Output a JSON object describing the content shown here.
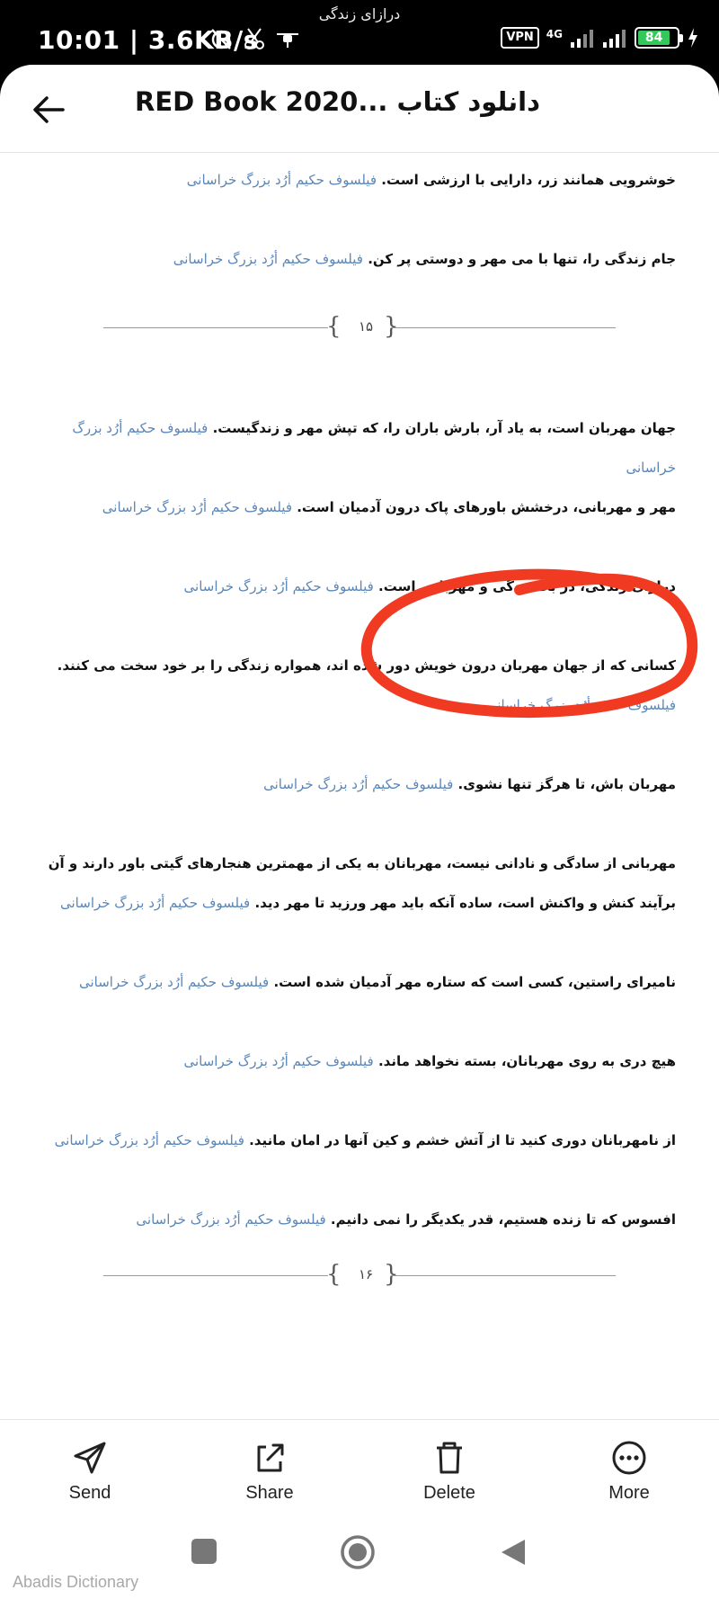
{
  "status_bar": {
    "notification_title": "درازای زندگی",
    "time": "10:01 | 3.6KB/s",
    "vpn": "VPN",
    "network": "4G",
    "battery": "84",
    "battery_level": 0.84
  },
  "header": {
    "title": "دانلود کتاب ...RED Book 2020"
  },
  "quotes": [
    {
      "text": "خوشرویی همانند زر، دارایی با ارزشی است.",
      "author": "فیلسوف حکیم أرُد بزرگ خراسانی"
    },
    {
      "text": "جام زندگی را، تنها با می مهر و دوستی پر کن.",
      "author": "فیلسوف حکیم أرُد بزرگ خراسانی"
    },
    {
      "text": "جهان مهربان است، به یاد آر، بارش باران را، که تپش مهر و زندگیست.",
      "author": "فیلسوف حکیم أرُد بزرگ خراسانی"
    },
    {
      "text": "مهر و مهربانی، درخشش باورهای پاک درون آدمیان است.",
      "author": "فیلسوف حکیم أرُد بزرگ خراسانی"
    },
    {
      "text": "درازای زندگی، در بخشندگی و مهربانی است.",
      "author": "فیلسوف حکیم أرُد بزرگ خراسانی"
    },
    {
      "text": "کسانی که از جهان مهربان درون خویش دور شده اند، همواره زندگی را بر خود سخت می کنند.",
      "author": "فیلسوف حکیم أرُد بزرگ خراسانی"
    },
    {
      "text": "مهربان باش، تا هرگز تنها نشوی.",
      "author": "فیلسوف حکیم أرُد بزرگ خراسانی"
    },
    {
      "text": "مهربانی از سادگی و نادانی نیست، مهربانان به یکی از مهمترین هنجارهای گیتی باور دارند و آن برآیند کنش و واکنش است، ساده آنکه باید مهر ورزید تا مهر دید.",
      "author": "فیلسوف حکیم أرُد بزرگ خراسانی"
    },
    {
      "text": "نامیرای راستین، کسی است که ستاره مهر آدمیان شده است.",
      "author": "فیلسوف حکیم أرُد بزرگ خراسانی"
    },
    {
      "text": "هیچ دری به روی مهربانان، بسته نخواهد ماند.",
      "author": "فیلسوف حکیم أرُد بزرگ خراسانی"
    },
    {
      "text": "از نامهربانان دوری کنید تا از آتش خشم و کین آنها در امان مانید.",
      "author": "فیلسوف حکیم أرُد بزرگ خراسانی"
    },
    {
      "text": "افسوس که تا زنده هستیم، قدر یکدیگر را نمی دانیم.",
      "author": "فیلسوف حکیم أرُد بزرگ خراسانی"
    }
  ],
  "page_markers": [
    "۱۵",
    "۱۶"
  ],
  "actions": {
    "send": "Send",
    "share": "Share",
    "delete": "Delete",
    "more": "More"
  },
  "watermark": "Abadis Dictionary",
  "colors": {
    "link": "#5a86b8",
    "annotation": "#f03a22",
    "battery": "#34c85a"
  }
}
